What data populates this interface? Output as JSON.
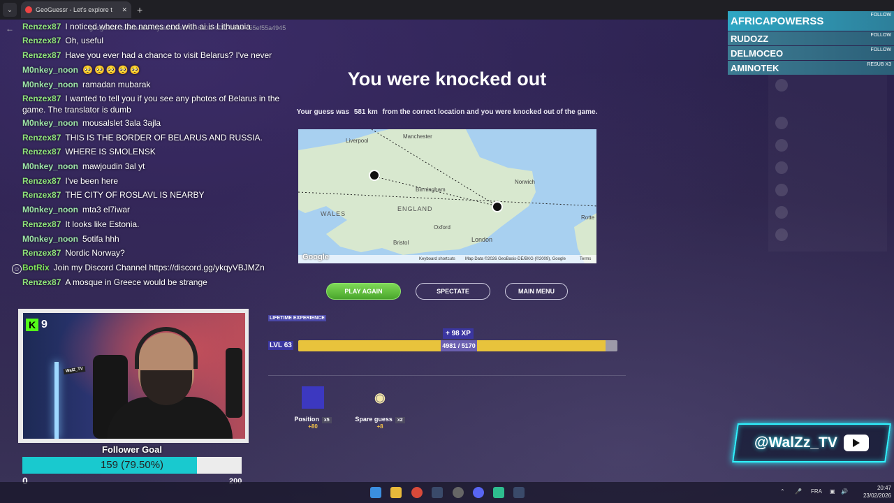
{
  "browser": {
    "tab_title": "GeoGuessr - Let's explore t",
    "new_tab": "+",
    "url": "geoguessr.com/battle-royale/aafec70c-6a0a-4712-a9be-c55ef55a4945"
  },
  "chat": {
    "messages": [
      {
        "user": "Renzex87",
        "text": "I noticed where the names end with ai is Lithuania"
      },
      {
        "user": "Renzex87",
        "text": "Oh, useful"
      },
      {
        "user": "Renzex87",
        "text": "Have you ever had a chance to visit Belarus? I've never"
      },
      {
        "user": "M0nkey_noon",
        "text": "🥺🥺🥺🥺🥺"
      },
      {
        "user": "M0nkey_noon",
        "text": "ramadan mubarak"
      },
      {
        "user": "Renzex87",
        "text": "I wanted to tell you if you see any photos of Belarus in the game. The translator is dumb"
      },
      {
        "user": "M0nkey_noon",
        "text": "mousalslet 3ala 3ajla"
      },
      {
        "user": "Renzex87",
        "text": "THIS IS THE BORDER OF BELARUS AND RUSSIA."
      },
      {
        "user": "Renzex87",
        "text": "WHERE IS SMOLENSK"
      },
      {
        "user": "M0nkey_noon",
        "text": "mawjoudin 3al yt"
      },
      {
        "user": "Renzex87",
        "text": "I've been here"
      },
      {
        "user": "Renzex87",
        "text": "THE CITY OF ROSLAVL IS NEARBY"
      },
      {
        "user": "M0nkey_noon",
        "text": "mta3 el7iwar"
      },
      {
        "user": "Renzex87",
        "text": "It looks like Estonia."
      },
      {
        "user": "M0nkey_noon",
        "text": "5otifa hhh"
      },
      {
        "user": "Renzex87",
        "text": "Nordic Norway?"
      },
      {
        "user": "BotRix",
        "text": "Join my Discord Channel https://discord.gg/ykqyVBJMZn"
      },
      {
        "user": "Renzex87",
        "text": "A mosque in Greece would be strange"
      }
    ]
  },
  "result": {
    "headline": "You were knocked out",
    "subline_prefix": "Your guess was",
    "distance": "581 km",
    "subline_suffix": "from the correct location and you were knocked out of the game."
  },
  "map": {
    "labels": {
      "manchester": "Manchester",
      "liverpool": "Liverpool",
      "birmingham": "Birmingham",
      "norwich": "Norwich",
      "wales": "WALES",
      "england": "ENGLAND",
      "oxford": "Oxford",
      "bristol": "Bristol",
      "london": "London",
      "rotte": "Rotte"
    },
    "footer_shortcuts": "Keyboard shortcuts",
    "footer_data": "Map Data ©2026 GeoBasis-DE/BKG (©2009), Google",
    "footer_terms": "Terms",
    "logo": "Google"
  },
  "buttons": {
    "play_again": "PLAY AGAIN",
    "spectate": "SPECTATE",
    "main_menu": "MAIN MENU"
  },
  "xp": {
    "title": "LIFETIME EXPERIENCE",
    "gain": "+ 98 XP",
    "level": "LVL 63",
    "progress_text": "4981 / 5170",
    "progress": 0.9633
  },
  "bonuses": [
    {
      "label": "Position",
      "mult": "x5",
      "points": "+80"
    },
    {
      "label": "Spare guess",
      "mult": "x2",
      "points": "+8"
    }
  ],
  "follows": [
    {
      "name": "AFRICAPOWERSS",
      "tag": "FOLLOW"
    },
    {
      "name": "RUDOZZ",
      "tag": "FOLLOW"
    },
    {
      "name": "DELMOCEO",
      "tag": "FOLLOW"
    },
    {
      "name": "AMINOTEK",
      "tag": "RESUB X3"
    }
  ],
  "stream": {
    "kick_viewers": "9",
    "cam_tag": "WalZ_TV",
    "goal_title": "Follower Goal",
    "goal_text": "159 (79.50%)",
    "goal_progress": 0.795,
    "goal_min": "0",
    "goal_max": "200",
    "brand": "@WalZz_TV"
  },
  "taskbar": {
    "lang": "FRA",
    "time": "20:47",
    "date": "23/02/2026"
  }
}
